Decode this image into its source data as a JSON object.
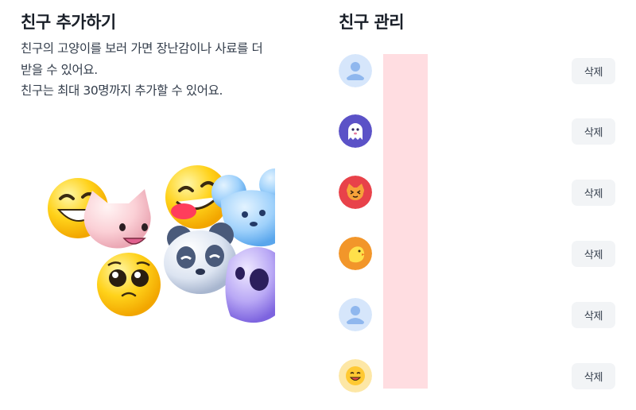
{
  "add_section": {
    "title": "친구 추가하기",
    "description_lines": [
      "친구의 고양이를 보러 가면 장난감이나 사료를 더",
      "받을 수 있어요.",
      "친구는 최대 30명까지 추가할 수 있어요."
    ]
  },
  "manage_section": {
    "title": "친구 관리",
    "friends": [
      {
        "avatar": "default-person-icon",
        "delete_label": "삭제"
      },
      {
        "avatar": "ghost-icon",
        "delete_label": "삭제"
      },
      {
        "avatar": "cat-face-icon",
        "delete_label": "삭제"
      },
      {
        "avatar": "chick-icon",
        "delete_label": "삭제"
      },
      {
        "avatar": "default-person-icon",
        "delete_label": "삭제"
      },
      {
        "avatar": "smiley-face-icon",
        "delete_label": "삭제"
      }
    ]
  },
  "colors": {
    "redacted": "#ffdde1",
    "button_bg": "#f2f4f6",
    "title_text": "#191f28"
  }
}
